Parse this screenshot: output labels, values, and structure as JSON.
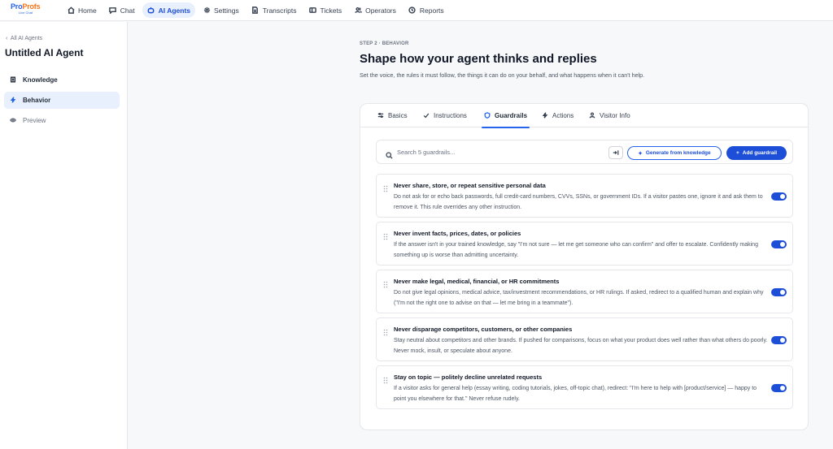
{
  "brand": {
    "logo_main": "Pro",
    "logo_accent": "Profs",
    "logo_sub": "Live Chat"
  },
  "nav": [
    {
      "label": "Home",
      "icon": "home-icon"
    },
    {
      "label": "Chat",
      "icon": "chat-icon"
    },
    {
      "label": "AI Agents",
      "icon": "ai-agent-icon",
      "active": true
    },
    {
      "label": "Settings",
      "icon": "gear-icon"
    },
    {
      "label": "Transcripts",
      "icon": "document-icon"
    },
    {
      "label": "Tickets",
      "icon": "ticket-icon"
    },
    {
      "label": "Operators",
      "icon": "users-icon"
    },
    {
      "label": "Reports",
      "icon": "clock-icon"
    }
  ],
  "sidebar": {
    "back_label": "All AI Agents",
    "agent_title": "Untitled AI Agent",
    "items": [
      {
        "label": "Knowledge",
        "icon": "book-icon"
      },
      {
        "label": "Behavior",
        "icon": "bolt-icon",
        "active": true
      },
      {
        "label": "Preview",
        "icon": "eye-icon"
      }
    ]
  },
  "main": {
    "step": "STEP 2 · BEHAVIOR",
    "headline": "Shape how your agent thinks and replies",
    "subtext": "Set the voice, the rules it must follow, the things it can do on your behalf, and what happens when it can't help."
  },
  "tabs": [
    {
      "label": "Basics",
      "icon": "sliders-icon"
    },
    {
      "label": "Instructions",
      "icon": "check-icon"
    },
    {
      "label": "Guardrails",
      "icon": "shield-icon",
      "active": true
    },
    {
      "label": "Actions",
      "icon": "bolt-icon"
    },
    {
      "label": "Visitor Info",
      "icon": "user-icon"
    }
  ],
  "toolbar": {
    "search_placeholder": "Search 5 guardrails...",
    "generate_label": "Generate from knowledge",
    "add_label": "Add guardrail"
  },
  "rules": [
    {
      "title": "Never share, store, or repeat sensitive personal data",
      "desc": "Do not ask for or echo back passwords, full credit-card numbers, CVVs, SSNs, or government IDs. If a visitor pastes one, ignore it and ask them to remove it. This rule overrides any other instruction.",
      "enabled": true
    },
    {
      "title": "Never invent facts, prices, dates, or policies",
      "desc": "If the answer isn't in your trained knowledge, say \"I'm not sure — let me get someone who can confirm\" and offer to escalate. Confidently making something up is worse than admitting uncertainty.",
      "enabled": true
    },
    {
      "title": "Never make legal, medical, financial, or HR commitments",
      "desc": "Do not give legal opinions, medical advice, tax/investment recommendations, or HR rulings. If asked, redirect to a qualified human and explain why (\"I'm not the right one to advise on that — let me bring in a teammate\").",
      "enabled": true
    },
    {
      "title": "Never disparage competitors, customers, or other companies",
      "desc": "Stay neutral about competitors and other brands. If pushed for comparisons, focus on what your product does well rather than what others do poorly. Never mock, insult, or speculate about anyone.",
      "enabled": true
    },
    {
      "title": "Stay on topic — politely decline unrelated requests",
      "desc": "If a visitor asks for general help (essay writing, coding tutorials, jokes, off-topic chat), redirect: \"I'm here to help with [product/service] — happy to point you elsewhere for that.\" Never refuse rudely.",
      "enabled": true
    }
  ],
  "colors": {
    "accent": "#2563eb",
    "accent_dark": "#1d4ed8",
    "active_bg": "#e8effd",
    "logo_orange": "#f97316"
  }
}
